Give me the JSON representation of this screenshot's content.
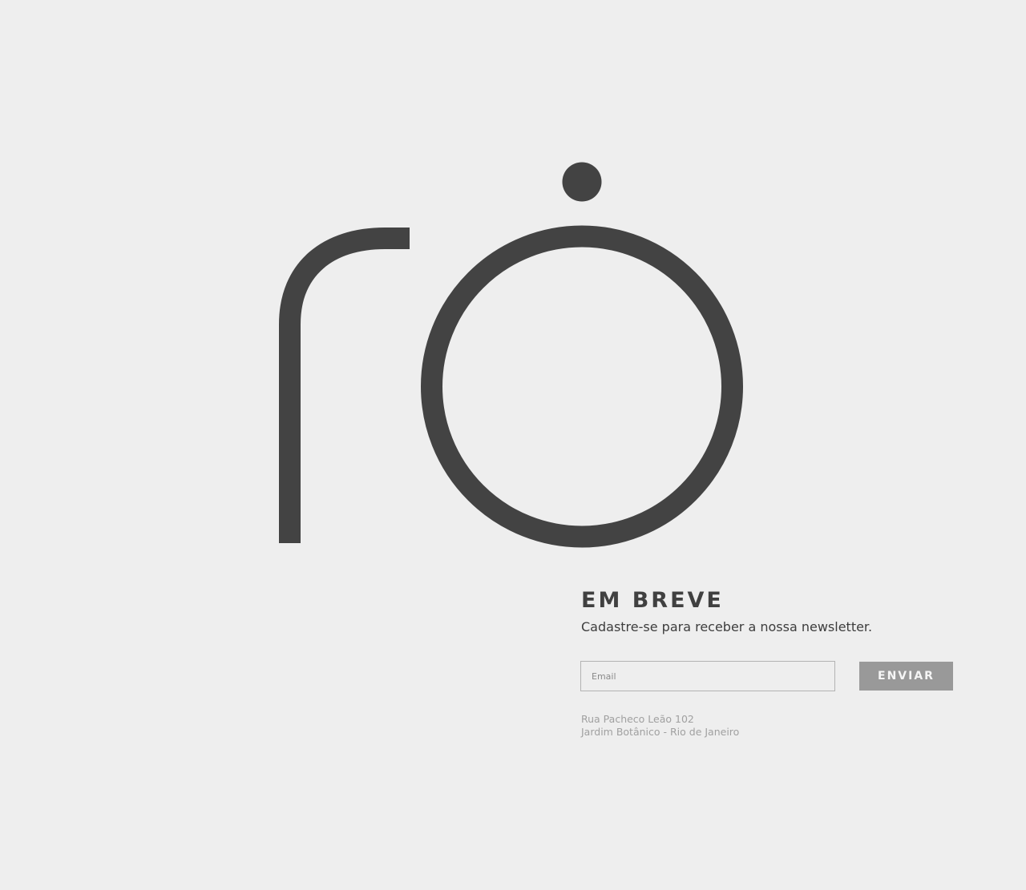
{
  "brand": {
    "logo_icon": "ro-logo-icon",
    "logo_color": "#434343"
  },
  "hero": {
    "title": "EM BREVE",
    "subtitle": "Cadastre-se para receber a nossa newsletter."
  },
  "newsletter": {
    "email_placeholder": "Email",
    "email_value": "",
    "send_label": "ENVIAR",
    "button_color": "#999999"
  },
  "address": {
    "line1": "Rua Pacheco Leão 102",
    "line2": "Jardim Botânico - Rio de Janeiro"
  },
  "colors": {
    "background": "#eeeeee",
    "text_dark": "#404040",
    "text_muted": "#a0a0a0"
  }
}
